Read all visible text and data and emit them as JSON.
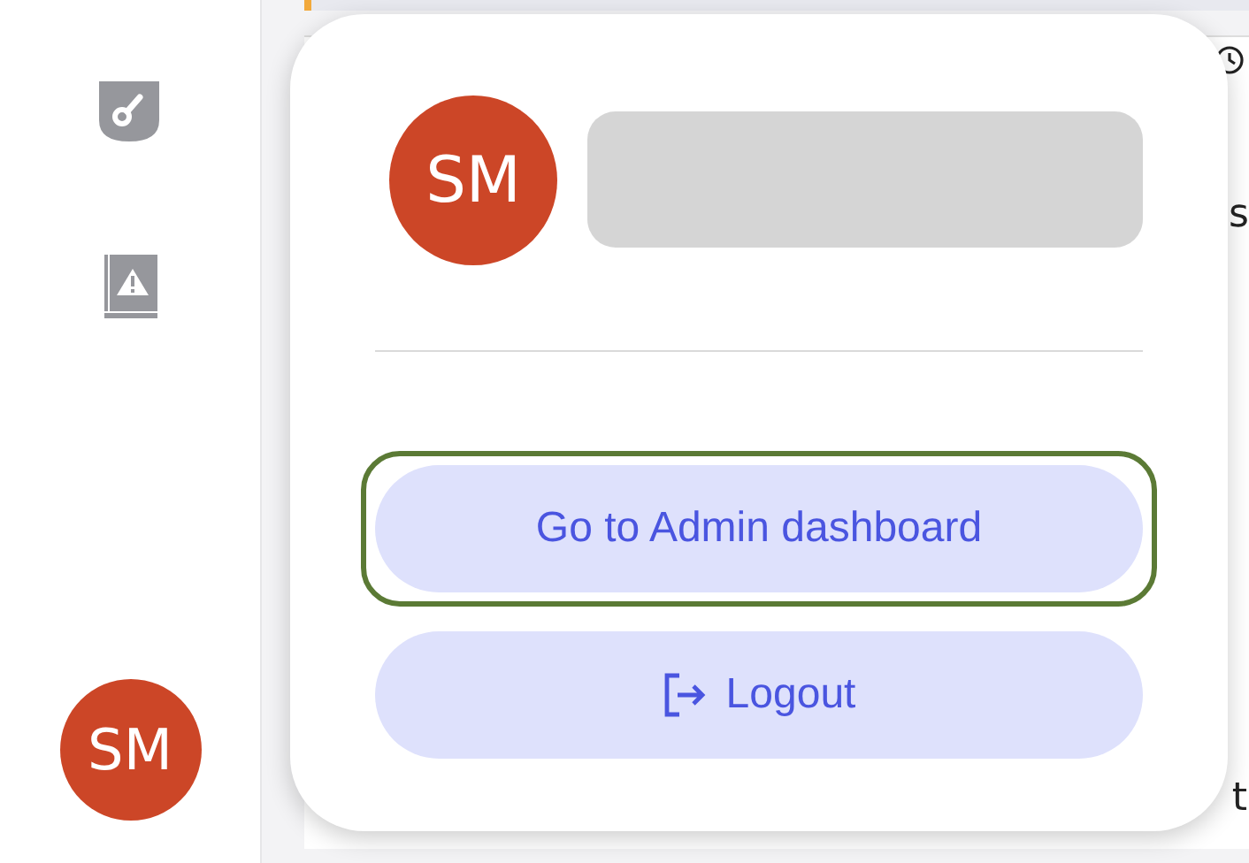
{
  "sidebar": {
    "avatar": {
      "initials": "SM"
    }
  },
  "background": {
    "fragments": [
      "s",
      "t"
    ]
  },
  "popup": {
    "avatar": {
      "initials": "SM"
    },
    "buttons": [
      {
        "label": "Go to Admin dashboard",
        "kind": "plain",
        "focused": true
      },
      {
        "label": "Logout",
        "kind": "logout",
        "focused": false
      }
    ]
  }
}
